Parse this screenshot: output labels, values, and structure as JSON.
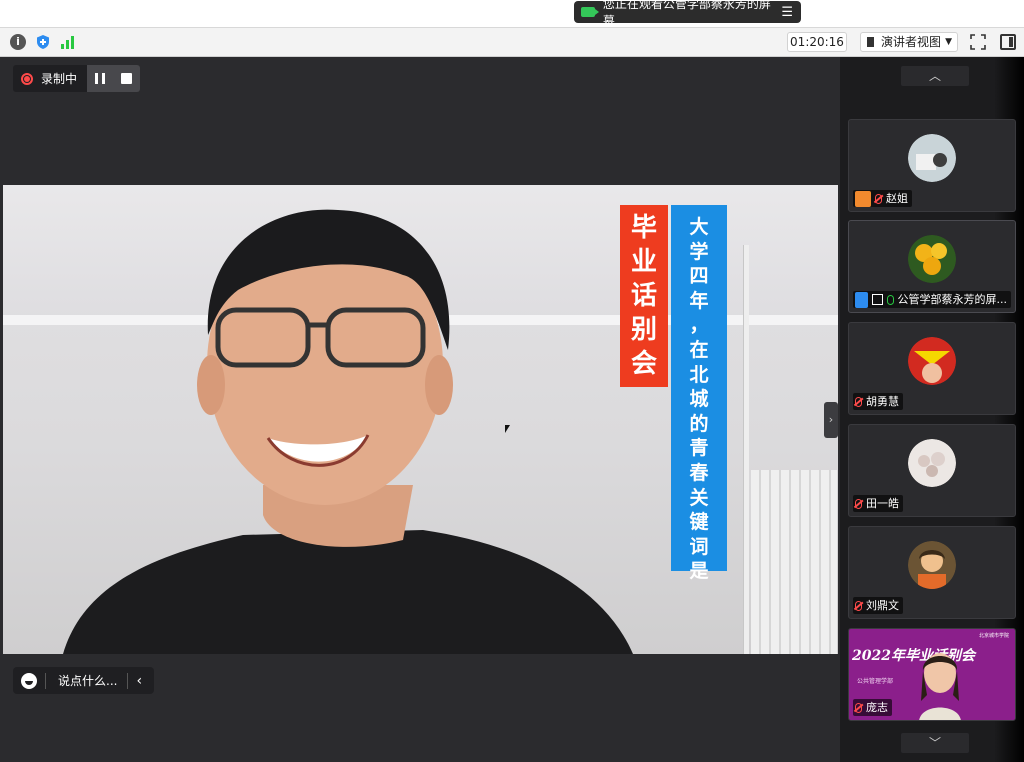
{
  "titlebar": {
    "share_notice": "您正在观看公管学部蔡永芳的屏幕",
    "menu_icon": "menu-icon"
  },
  "toolbar": {
    "timer": "01:20:16",
    "view_mode": "演讲者视图",
    "icons": [
      "info-icon",
      "shield-icon",
      "signal-icon",
      "fullscreen-icon",
      "side-panel-icon"
    ]
  },
  "recording": {
    "label": "录制中"
  },
  "video": {
    "banner_red": [
      "毕",
      "业",
      "话",
      "别",
      "会"
    ],
    "banner_blue": [
      "大",
      "学",
      "四",
      "年",
      "，",
      "在",
      "北",
      "城",
      "的",
      "青",
      "春",
      "关",
      "键",
      "词",
      "是"
    ]
  },
  "chat": {
    "placeholder": "说点什么..."
  },
  "participants": [
    {
      "name": "赵姐",
      "mic": "muted",
      "badge": "user"
    },
    {
      "name": "公管学部蔡永芳的屏...",
      "mic": "on",
      "badge": "host-share"
    },
    {
      "name": "胡勇慧",
      "mic": "muted"
    },
    {
      "name": "田一皓",
      "mic": "muted"
    },
    {
      "name": "刘鼎文",
      "mic": "muted"
    },
    {
      "name": "庞志",
      "mic": "muted",
      "video": {
        "title": "2022年毕业话别会",
        "subtitle": "公共管理学部",
        "school": "北京城市学院"
      }
    }
  ],
  "colors": {
    "banner_red": "#ee3c1f",
    "banner_blue": "#1b8ee3",
    "mic_muted": "#ff4b4b",
    "mic_on": "#28c840",
    "tile_bg": "#2b2b2e"
  }
}
